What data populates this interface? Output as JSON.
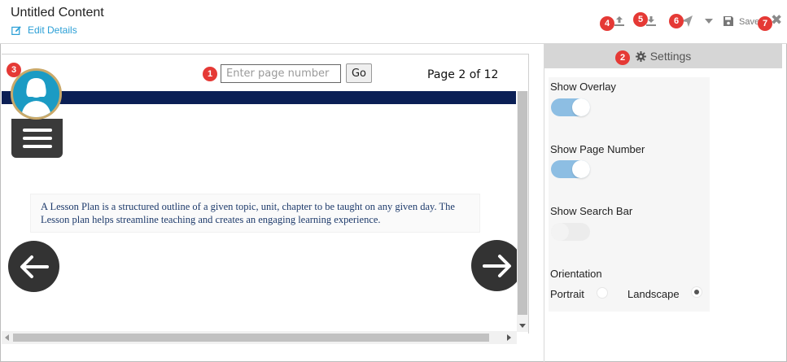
{
  "header": {
    "title": "Untitled Content",
    "edit_details": "Edit Details",
    "toolbar": {
      "upload_icon": "upload-icon",
      "download_icon": "download-icon",
      "publish_icon": "send-icon",
      "dropdown_icon": "caret-down-icon",
      "save_icon": "floppy-disk-icon",
      "save_label": "Save",
      "close_icon": "close-icon",
      "close_glyph": "✖"
    }
  },
  "badges": [
    "1",
    "2",
    "3",
    "4",
    "5",
    "6",
    "7"
  ],
  "preview": {
    "page_input_placeholder": "Enter page number",
    "go_label": "Go",
    "page_indicator": "Page 2 of 12",
    "content_text": "A Lesson Plan is a structured outline of a given topic, unit, chapter to be taught on any given day. The Lesson plan helps streamline teaching and creates an engaging learning experience.",
    "prev_icon": "arrow-left-icon",
    "next_icon": "arrow-right-icon",
    "menu_icon": "hamburger-menu-icon",
    "avatar_icon": "user-avatar-icon"
  },
  "settings": {
    "title": "Settings",
    "show_overlay": {
      "label": "Show Overlay",
      "on": true
    },
    "show_page_number": {
      "label": "Show Page Number",
      "on": true
    },
    "show_search_bar": {
      "label": "Show Search Bar",
      "on": false
    },
    "orientation": {
      "label": "Orientation",
      "options": [
        "Portrait",
        "Landscape"
      ],
      "selected": "Landscape"
    }
  },
  "colors": {
    "accent_link": "#2a9fd6",
    "navy_bar": "#0b1f55",
    "badge": "#e53935",
    "toggle_on": "#8dbee3",
    "avatar_bg": "#1b9bc4"
  }
}
